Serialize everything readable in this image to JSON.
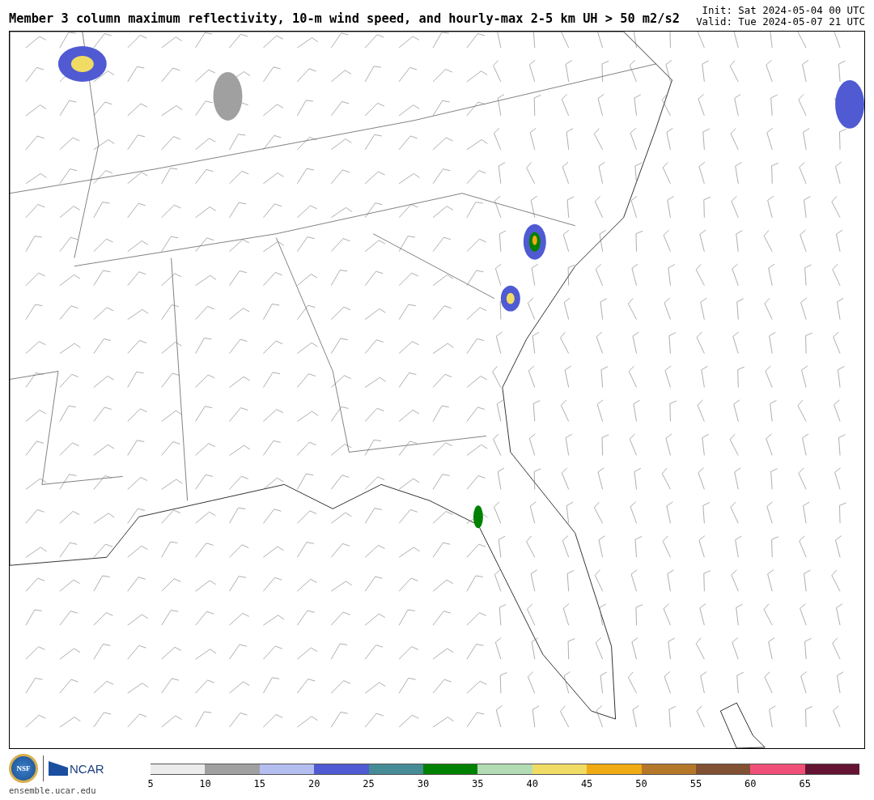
{
  "title": "Member 3 column maximum reflectivity, 10-m wind speed, and hourly-max 2-5 km UH > 50 m2/s2",
  "init": "Init: Sat 2024-05-04 00 UTC",
  "valid": "Valid: Tue 2024-05-07 21 UTC",
  "logos": {
    "nsf": "NSF",
    "ncar": "NCAR",
    "site": "ensemble.ucar.edu"
  },
  "colorbar": {
    "segments": [
      {
        "color": "#ececec",
        "label": "5"
      },
      {
        "color": "#a0a0a0",
        "label": "10"
      },
      {
        "color": "#b4bef0",
        "label": "15"
      },
      {
        "color": "#505ad2",
        "label": "20"
      },
      {
        "color": "#468c96",
        "label": "25"
      },
      {
        "color": "#008200",
        "label": "30"
      },
      {
        "color": "#b4dcb4",
        "label": "35"
      },
      {
        "color": "#f0dc64",
        "label": "40"
      },
      {
        "color": "#f0aa14",
        "label": "45"
      },
      {
        "color": "#b47828",
        "label": "50"
      },
      {
        "color": "#825032",
        "label": "55"
      },
      {
        "color": "#f05078",
        "label": "60"
      },
      {
        "color": "#641432",
        "label": "65"
      }
    ]
  }
}
